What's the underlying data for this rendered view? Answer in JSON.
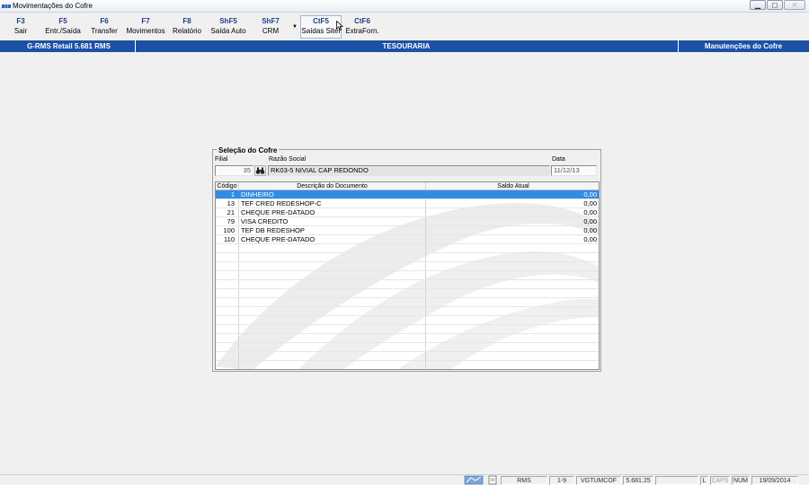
{
  "window": {
    "title": "Movimentações do Cofre",
    "controls": {
      "minimize": "▁",
      "restore": "◻",
      "close": "✕"
    }
  },
  "toolbar": {
    "buttons": [
      {
        "key": "F3",
        "label": "Sair"
      },
      {
        "key": "F5",
        "label": "Entr./Saída"
      },
      {
        "key": "F6",
        "label": "Transfer"
      },
      {
        "key": "F7",
        "label": "Movimentos"
      },
      {
        "key": "F8",
        "label": "Relatório"
      },
      {
        "key": "ShF5",
        "label": "Saída Auto"
      },
      {
        "key": "ShF7",
        "label": "CRM"
      },
      {
        "key": "CtF5",
        "label": "Saídas Sitef"
      },
      {
        "key": "CtF6",
        "label": "ExtraForn."
      }
    ],
    "more_arrow": "▼"
  },
  "band": {
    "left": "G-RMS Retail 5.681 RMS",
    "center": "TESOURARIA",
    "right": "Manutenções do Cofre"
  },
  "panel": {
    "title": "Seleção do Cofre",
    "filial_label": "Filial",
    "filial_value": "35",
    "razao_label": "Razão Social",
    "razao_value": "RK03-5 NIVIAL CAP REDONDO",
    "data_label": "Data",
    "data_value": "11/12/13",
    "search_icon": "binoculars-icon"
  },
  "grid": {
    "columns": [
      "Código",
      "Descrição do Documento",
      "Saldo Atual"
    ],
    "rows": [
      {
        "code": "1",
        "desc": "DINHEIRO",
        "saldo": "0,00"
      },
      {
        "code": "13",
        "desc": "TEF CRED REDESHOP-C",
        "saldo": "0,00"
      },
      {
        "code": "21",
        "desc": "CHEQUE PRE-DATADO",
        "saldo": "0,00"
      },
      {
        "code": "79",
        "desc": "VISA CREDITO",
        "saldo": "0,00"
      },
      {
        "code": "100",
        "desc": "TEF DB REDESHOP",
        "saldo": "0,00"
      },
      {
        "code": "110",
        "desc": "CHEQUE PRE-DATADO",
        "saldo": "0,00"
      }
    ],
    "selected_row": 0
  },
  "statusbar": {
    "system": "RMS",
    "range": "1-9",
    "program": "VGTUMCOF",
    "version": "5.681.25",
    "blank": "",
    "l": "L",
    "caps": "CAPS",
    "num": "NUM",
    "date": "19/09/2014"
  },
  "colors": {
    "band": "#1c51a6",
    "selection": "#2f8de4",
    "toolbar_key": "#1c3f86"
  }
}
